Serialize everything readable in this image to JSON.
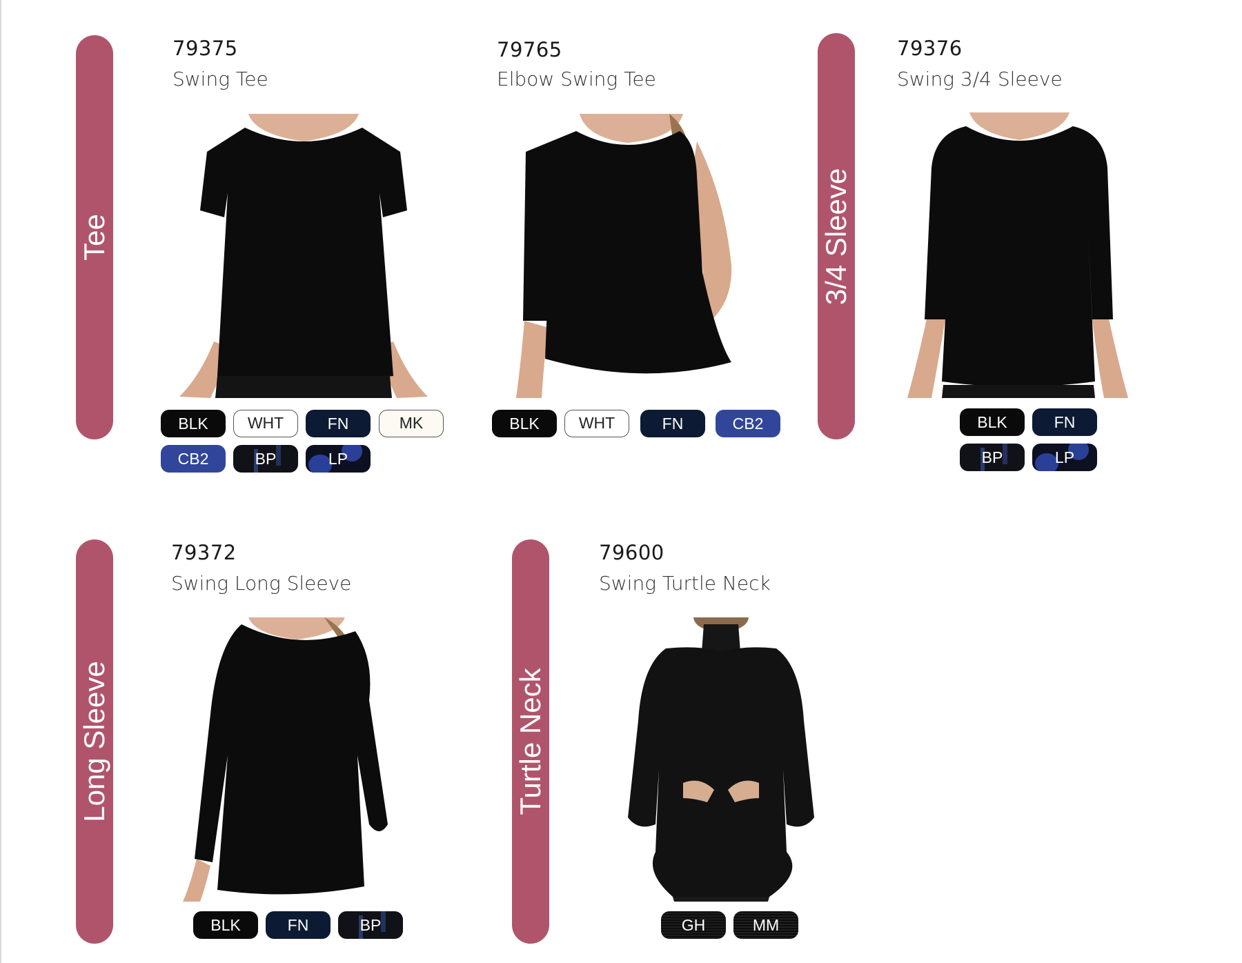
{
  "sections": {
    "tee": "Tee",
    "three_quarter": "3/4 Sleeve",
    "long_sleeve": "Long Sleeve",
    "turtle_neck": "Turtle Neck"
  },
  "products": [
    {
      "code": "79375",
      "name": "Swing Tee",
      "colors": [
        "BLK",
        "WHT",
        "FN",
        "MK",
        "CB2",
        "BP",
        "LP"
      ]
    },
    {
      "code": "79765",
      "name": "Elbow Swing Tee",
      "colors": [
        "BLK",
        "WHT",
        "FN",
        "CB2"
      ]
    },
    {
      "code": "79376",
      "name": "Swing 3/4 Sleeve",
      "colors": [
        "BLK",
        "FN",
        "BP",
        "LP"
      ]
    },
    {
      "code": "79372",
      "name": "Swing Long Sleeve",
      "colors": [
        "BLK",
        "FN",
        "BP"
      ]
    },
    {
      "code": "79600",
      "name": "Swing Turtle Neck",
      "colors": [
        "GH",
        "MM"
      ]
    }
  ],
  "palette": {
    "tab": "#b0546c",
    "garment": "#0c0c0c",
    "skin": "#dcb096",
    "hair": "#9a7350"
  }
}
